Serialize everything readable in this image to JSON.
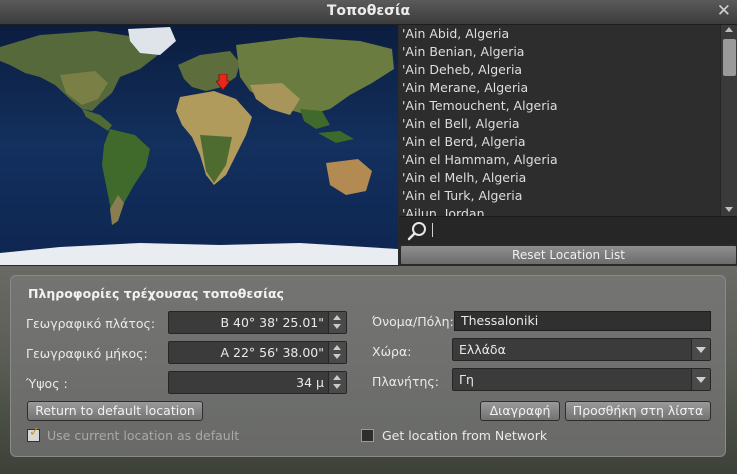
{
  "window": {
    "title": "Τοποθεσία"
  },
  "map": {
    "pin_color": "#e8261b"
  },
  "locations": [
    "'Ain Abid, Algeria",
    "'Ain Benian, Algeria",
    "'Ain Deheb, Algeria",
    "'Ain Merane, Algeria",
    "'Ain Temouchent, Algeria",
    "'Ain el Bell, Algeria",
    "'Ain el Berd, Algeria",
    "'Ain el Hammam, Algeria",
    "'Ain el Melh, Algeria",
    "'Ain el Turk, Algeria",
    "'Ajlun, Jordan"
  ],
  "search": {
    "value": ""
  },
  "reset_button": "Reset Location List",
  "info": {
    "section_title": "Πληροφορίες τρέχουσας τοποθεσίας",
    "latitude_label": "Γεωγραφικό πλάτος:",
    "latitude_value": "Β 40° 38' 25.01\"",
    "longitude_label": "Γεωγραφικό μήκος:",
    "longitude_value": "Α 22° 56' 38.00\"",
    "altitude_label": "Ύψος :",
    "altitude_value": "34 μ",
    "name_label": "Όνομα/Πόλη:",
    "name_value": "Thessaloniki",
    "country_label": "Χώρα:",
    "country_value": "Ελλάδα",
    "planet_label": "Πλανήτης:",
    "planet_value": "Γη"
  },
  "buttons": {
    "return_default": "Return to default location",
    "delete": "Διαγραφή",
    "add_to_list": "Προσθήκη στη λίστα"
  },
  "checkboxes": {
    "use_current_default": "Use current location as default",
    "use_current_default_checked": true,
    "network_location": "Get location from Network",
    "network_location_checked": false
  }
}
